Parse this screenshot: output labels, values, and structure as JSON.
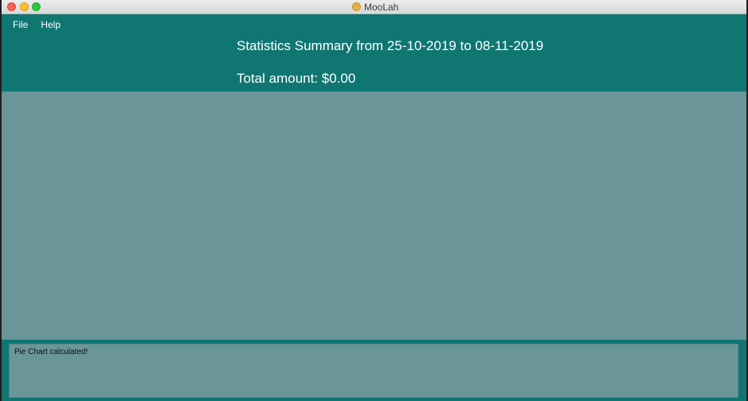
{
  "window": {
    "title": "MooLah"
  },
  "menu": {
    "items": [
      "File",
      "Help"
    ]
  },
  "statistics": {
    "title": "Statistics Summary from 25-10-2019 to 08-11-2019",
    "total": "Total amount: $0.00"
  },
  "result": {
    "message": "Pie Chart calculated!"
  },
  "colors": {
    "header": "#0f7672",
    "panel": "#6a9599"
  },
  "icons": {
    "app": "moolah-app-icon"
  }
}
